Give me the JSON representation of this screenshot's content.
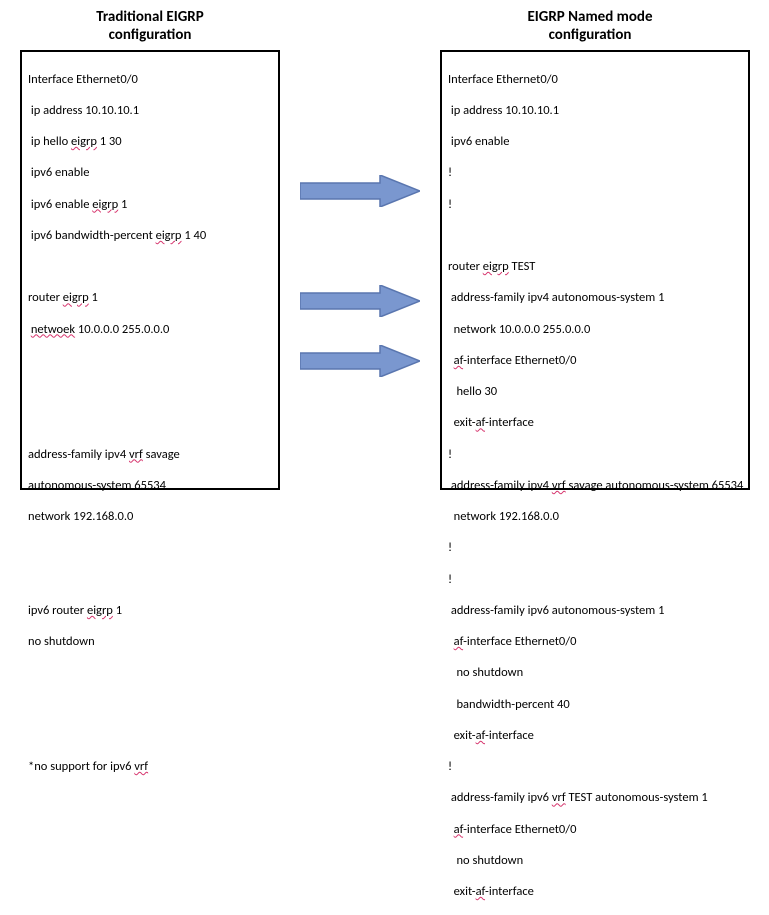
{
  "titles": {
    "left_line1": "Traditional  EIGRP",
    "left_line2": "configuration",
    "right_line1": "EIGRP Named mode",
    "right_line2": "configuration"
  },
  "left": {
    "l0": "Interface Ethernet0/0",
    "l1": " ip address 10.10.10.1",
    "l2_a": " ip hello ",
    "l2_b": "eigrp",
    "l2_c": " 1 30",
    "l3": " ipv6 enable",
    "l4_a": " ipv6 enable ",
    "l4_b": "eigrp",
    "l4_c": " 1",
    "l5_a": " ipv6 bandwidth-percent ",
    "l5_b": "eigrp",
    "l5_c": " 1 40",
    "l6": " ",
    "l7_a": "router ",
    "l7_b": "eigrp",
    "l7_c": " 1",
    "l8_a": " ",
    "l8_b": "netwoek",
    "l8_c": " 10.0.0.0 255.0.0.0",
    "l9": " ",
    "l10": " ",
    "l11": " ",
    "l12_a": "address-family ipv4 ",
    "l12_b": "vrf",
    "l12_c": " savage",
    "l13": "autonomous-system 65534",
    "l14": "network 192.168.0.0",
    "l15": " ",
    "l16": " ",
    "l17_a": "ipv6 router ",
    "l17_b": "eigrp",
    "l17_c": " 1",
    "l18": "no shutdown",
    "l19": " ",
    "l20": " ",
    "l21": " ",
    "l22_a": "*no support for ipv6 ",
    "l22_b": "vrf"
  },
  "right": {
    "r0": "Interface Ethernet0/0",
    "r1": " ip address 10.10.10.1",
    "r2": " ipv6 enable",
    "r3": "!",
    "r4": "!",
    "r5": " ",
    "r6_a": "router ",
    "r6_b": "eigrp",
    "r6_c": " TEST",
    "r7": " address-family ipv4 autonomous-system 1",
    "r8": "  network 10.0.0.0 255.0.0.0",
    "r9_a": "  ",
    "r9_b": "af",
    "r9_c": "-interface Ethernet0/0",
    "r10": "   hello 30",
    "r11_a": "  exit-",
    "r11_b": "af",
    "r11_c": "-interface",
    "r12": "!",
    "r13_a": " address-family ipv4 ",
    "r13_b": "vrf",
    "r13_c": " savage autonomous-system 65534",
    "r14": "  network 192.168.0.0",
    "r15": "!",
    "r16": "!",
    "r17": " address-family ipv6 autonomous-system 1",
    "r18_a": "  ",
    "r18_b": "af",
    "r18_c": "-interface Ethernet0/0",
    "r19": "   no shutdown",
    "r20": "   bandwidth-percent 40",
    "r21_a": "  exit-",
    "r21_b": "af",
    "r21_c": "-interface",
    "r22": "!",
    "r23_a": " address-family ipv6 ",
    "r23_b": "vrf",
    "r23_c": " TEST autonomous-system 1",
    "r24_a": "  ",
    "r24_b": "af",
    "r24_c": "-interface Ethernet0/0",
    "r25": "   no shutdown",
    "r26_a": "  exit-",
    "r26_b": "af",
    "r26_c": "-interface"
  },
  "colors": {
    "arrow_fill": "#7a97cf",
    "arrow_stroke": "#5a76af"
  }
}
